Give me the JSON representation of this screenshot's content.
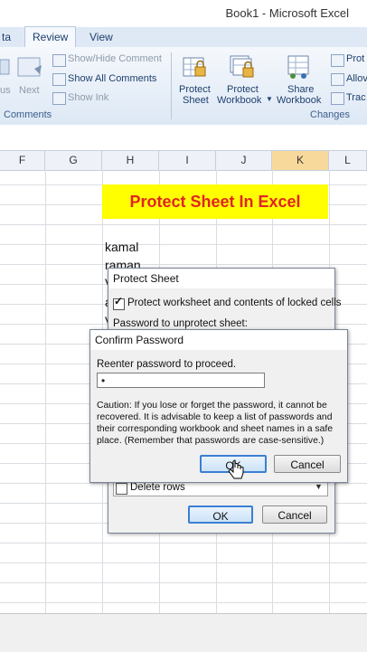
{
  "window": {
    "title": "Book1 - Microsoft Excel"
  },
  "tabs": [
    {
      "label": "ta"
    },
    {
      "label": "Review",
      "active": true
    },
    {
      "label": "View"
    }
  ],
  "ribbon": {
    "comments_group": {
      "prev_label": "us",
      "next_label": "Next",
      "show_hide_comment": "Show/Hide Comment",
      "show_all_comments": "Show All Comments",
      "show_ink": "Show Ink",
      "group_label": "Comments"
    },
    "changes_group": {
      "protect_sheet": [
        "Protect",
        "Sheet"
      ],
      "protect_workbook": [
        "Protect",
        "Workbook"
      ],
      "share_workbook": [
        "Share",
        "Workbook"
      ],
      "side_items": [
        "Prot",
        "Allov",
        "Trac"
      ],
      "group_label": "Changes"
    }
  },
  "columns": [
    {
      "label": "F"
    },
    {
      "label": "G"
    },
    {
      "label": "H"
    },
    {
      "label": "I"
    },
    {
      "label": "J"
    },
    {
      "label": "K",
      "selected": true
    },
    {
      "label": "L"
    }
  ],
  "sheet": {
    "banner": "Protect Sheet In Excel",
    "cells": [
      "kamal",
      "raman",
      "V",
      "a",
      "V"
    ]
  },
  "protect_dialog": {
    "title": "Protect Sheet",
    "protect_checkbox_label": "Protect worksheet and contents of locked cells",
    "password_label": "Password to unprotect sheet:",
    "delete_rows_label": "Delete rows",
    "ok": "OK",
    "cancel": "Cancel"
  },
  "confirm_dialog": {
    "title": "Confirm Password",
    "prompt": "Reenter password to proceed.",
    "password_value": "•",
    "caution": [
      "Caution: If you lose or forget the password, it cannot be",
      "recovered. It is advisable to keep a list of passwords and",
      "their corresponding workbook and sheet names in a safe",
      "place.  (Remember that passwords are case-sensitive.)"
    ],
    "ok": "OK",
    "cancel": "Cancel"
  },
  "colors": {
    "banner_bg": "#ffff00",
    "banner_text": "#e02424",
    "selected_col": "#f7d99c"
  },
  "icons": [
    "lock-sheet-icon",
    "lock-workbook-icon",
    "share-workbook-icon",
    "comment-icon",
    "cursor-pointer-icon"
  ]
}
